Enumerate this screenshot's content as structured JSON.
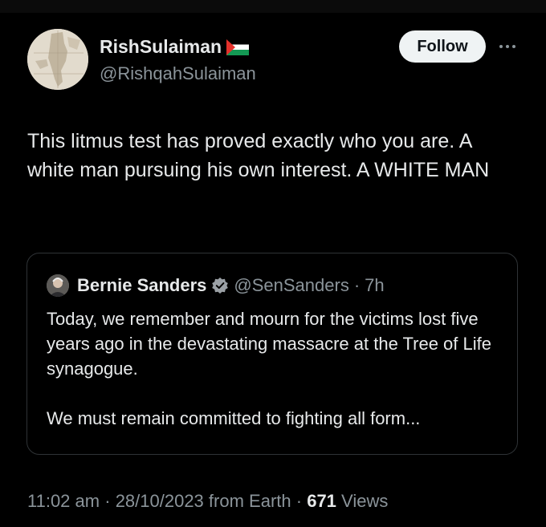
{
  "author": {
    "display_name": "RishSulaiman",
    "flag_icon": "palestine-flag-icon",
    "handle": "@RishqahSulaiman",
    "avatar_icon": "map-avatar"
  },
  "actions": {
    "follow_label": "Follow",
    "more_icon": "more-horizontal-icon"
  },
  "tweet": {
    "text": "This litmus test has proved exactly who you are. A white man pursuing his own interest. A WHITE MAN"
  },
  "quoted_tweet": {
    "display_name": "Bernie Sanders",
    "verified_icon": "verified-badge-icon",
    "handle": "@SenSanders",
    "separator": "·",
    "time": "7h",
    "text": "Today, we remember and mourn for the victims lost five years ago in the devastating massacre at the Tree of Life synagogue.\n\nWe must remain committed to fighting all form..."
  },
  "meta": {
    "time": "11:02 am",
    "sep1": "·",
    "date": "28/10/2023",
    "source": "from Earth",
    "sep2": "·",
    "views_count": "671",
    "views_label": "Views"
  },
  "colors": {
    "background": "#000000",
    "text_primary": "#e7e9ea",
    "text_secondary": "#8b949a",
    "border": "#2f3336",
    "follow_bg": "#eff3f4",
    "verified_gray": "#9ba1a6"
  }
}
